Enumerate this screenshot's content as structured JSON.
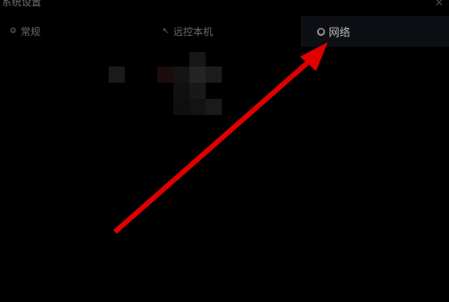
{
  "window": {
    "title": "系统设置",
    "close_icon": "close-icon"
  },
  "tabs": [
    {
      "label": "常规",
      "icon": "gear-icon",
      "active": false
    },
    {
      "label": "远控本机",
      "icon": "remote-icon",
      "active": false
    },
    {
      "label": "网络",
      "icon": "network-icon",
      "active": true
    }
  ],
  "annotation": {
    "type": "arrow",
    "color": "#e00000",
    "points_to": "tab-network"
  },
  "colors": {
    "background": "#000000",
    "active_tab_bg": "#0d0f14",
    "text_dim": "#6a6a6a",
    "text_active": "#b8b8b8"
  }
}
